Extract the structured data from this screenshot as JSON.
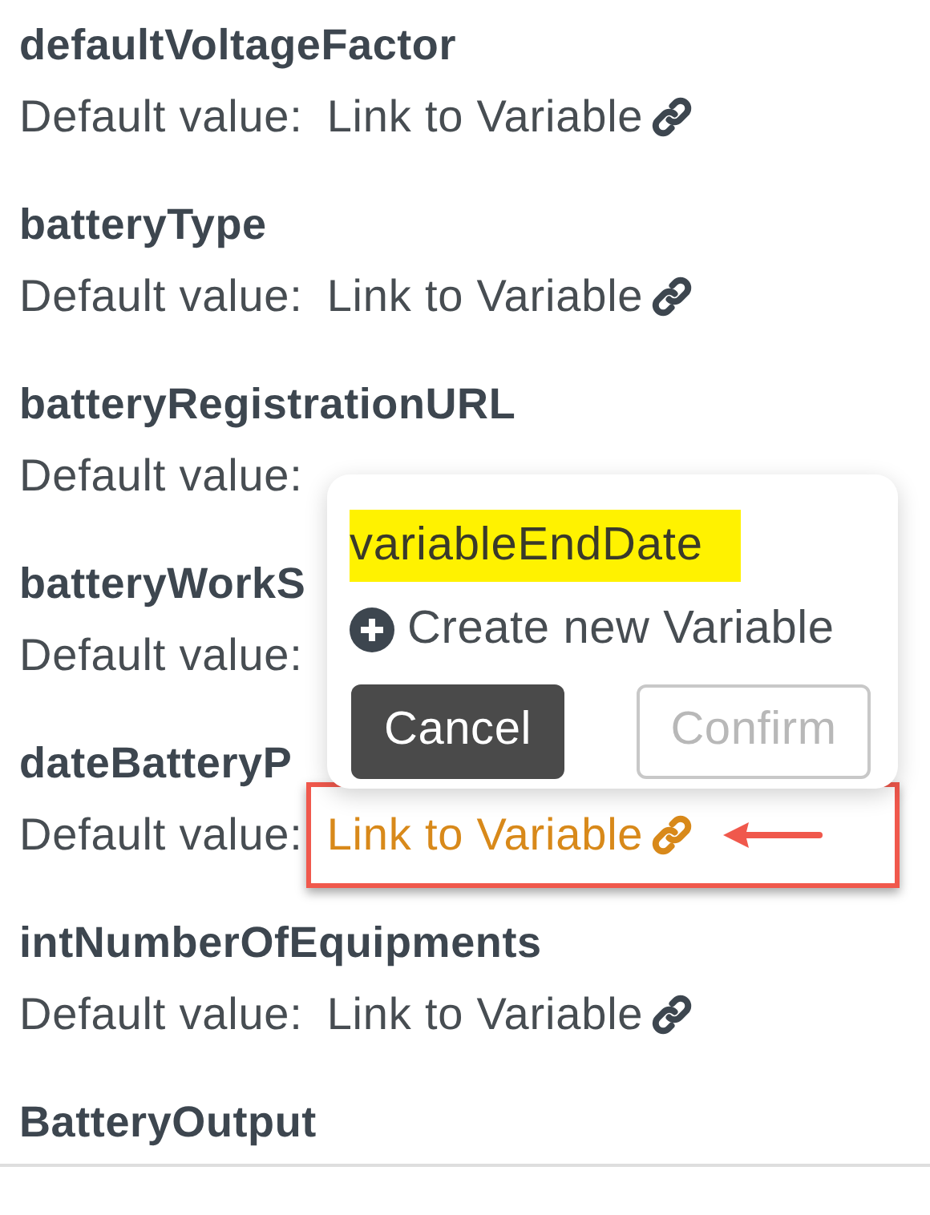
{
  "fields": [
    {
      "name": "defaultVoltageFactor",
      "default_label": "Default value:",
      "link": {
        "label": "Link to Variable",
        "highlighted": false
      }
    },
    {
      "name": "batteryType",
      "default_label": "Default value:",
      "link": {
        "label": "Link to Variable",
        "highlighted": false
      }
    },
    {
      "name": "batteryRegistrationURL",
      "default_label": "Default value:"
    },
    {
      "name": "batteryWorkS",
      "default_label": "Default value:"
    },
    {
      "name": "dateBatteryP",
      "default_label": "Default value:",
      "link": {
        "label": "Link to Variable",
        "highlighted": true
      }
    },
    {
      "name": "intNumberOfEquipments",
      "default_label": "Default value:",
      "link": {
        "label": "Link to Variable",
        "highlighted": false
      }
    },
    {
      "name": "BatteryOutput"
    }
  ],
  "popup": {
    "search_value": "variableEndDate",
    "create_label": "Create new Variable",
    "buttons": [
      {
        "label": "Cancel",
        "kind": "primary",
        "disabled": false
      },
      {
        "label": "Confirm",
        "kind": "secondary",
        "disabled": true
      }
    ]
  }
}
